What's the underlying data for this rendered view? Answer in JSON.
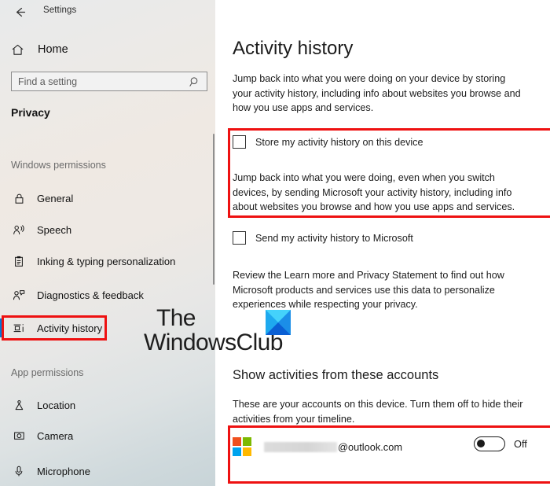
{
  "window": {
    "back_icon": "back-arrow-icon",
    "title": "Settings"
  },
  "sidebar": {
    "home": {
      "label": "Home",
      "icon": "home-icon"
    },
    "search": {
      "placeholder": "Find a setting",
      "value": "",
      "icon": "search-icon"
    },
    "section_title": "Privacy",
    "groups": [
      {
        "label": "Windows permissions",
        "items": [
          {
            "label": "General",
            "icon": "lock-icon",
            "selected": false
          },
          {
            "label": "Speech",
            "icon": "speech-person-icon",
            "selected": false
          },
          {
            "label": "Inking & typing personalization",
            "icon": "clipboard-icon",
            "selected": false
          },
          {
            "label": "Diagnostics & feedback",
            "icon": "person-feedback-icon",
            "selected": false
          },
          {
            "label": "Activity history",
            "icon": "activity-history-icon",
            "selected": true
          }
        ]
      },
      {
        "label": "App permissions",
        "items": [
          {
            "label": "Location",
            "icon": "location-pin-icon",
            "selected": false
          },
          {
            "label": "Camera",
            "icon": "camera-icon",
            "selected": false
          },
          {
            "label": "Microphone",
            "icon": "microphone-icon",
            "selected": false
          }
        ]
      }
    ]
  },
  "main": {
    "page_title": "Activity history",
    "intro_text": "Jump back into what you were doing on your device by storing your activity history, including info about websites you browse and how you use apps and services.",
    "store_checkbox": {
      "label": "Store my activity history on this device",
      "checked": false
    },
    "sync_text": "Jump back into what you were doing, even when you switch devices, by sending Microsoft your activity history, including info about websites you browse and how you use apps and services.",
    "send_checkbox": {
      "label": "Send my activity history to Microsoft",
      "checked": false
    },
    "privacy_text": "Review the Learn more and Privacy Statement to find out how Microsoft products and services use this data to personalize experiences while respecting your privacy.",
    "accounts": {
      "heading": "Show activities from these accounts",
      "description": "These are your accounts on this device. Turn them off to hide their activities from your timeline.",
      "row": {
        "logo": "microsoft-logo-icon",
        "email_suffix": "@outlook.com",
        "toggle_state": "Off",
        "toggle_on": false
      }
    }
  },
  "watermark": {
    "line1": "The",
    "line2": "WindowsClub",
    "logo": "windowsclub-logo-icon"
  },
  "colors": {
    "accent": "#0078d7",
    "annotation": "#ee1111",
    "ms_red": "#f0501e",
    "ms_green": "#7cb900",
    "ms_blue": "#00a3ee",
    "ms_yellow": "#ffb900"
  }
}
